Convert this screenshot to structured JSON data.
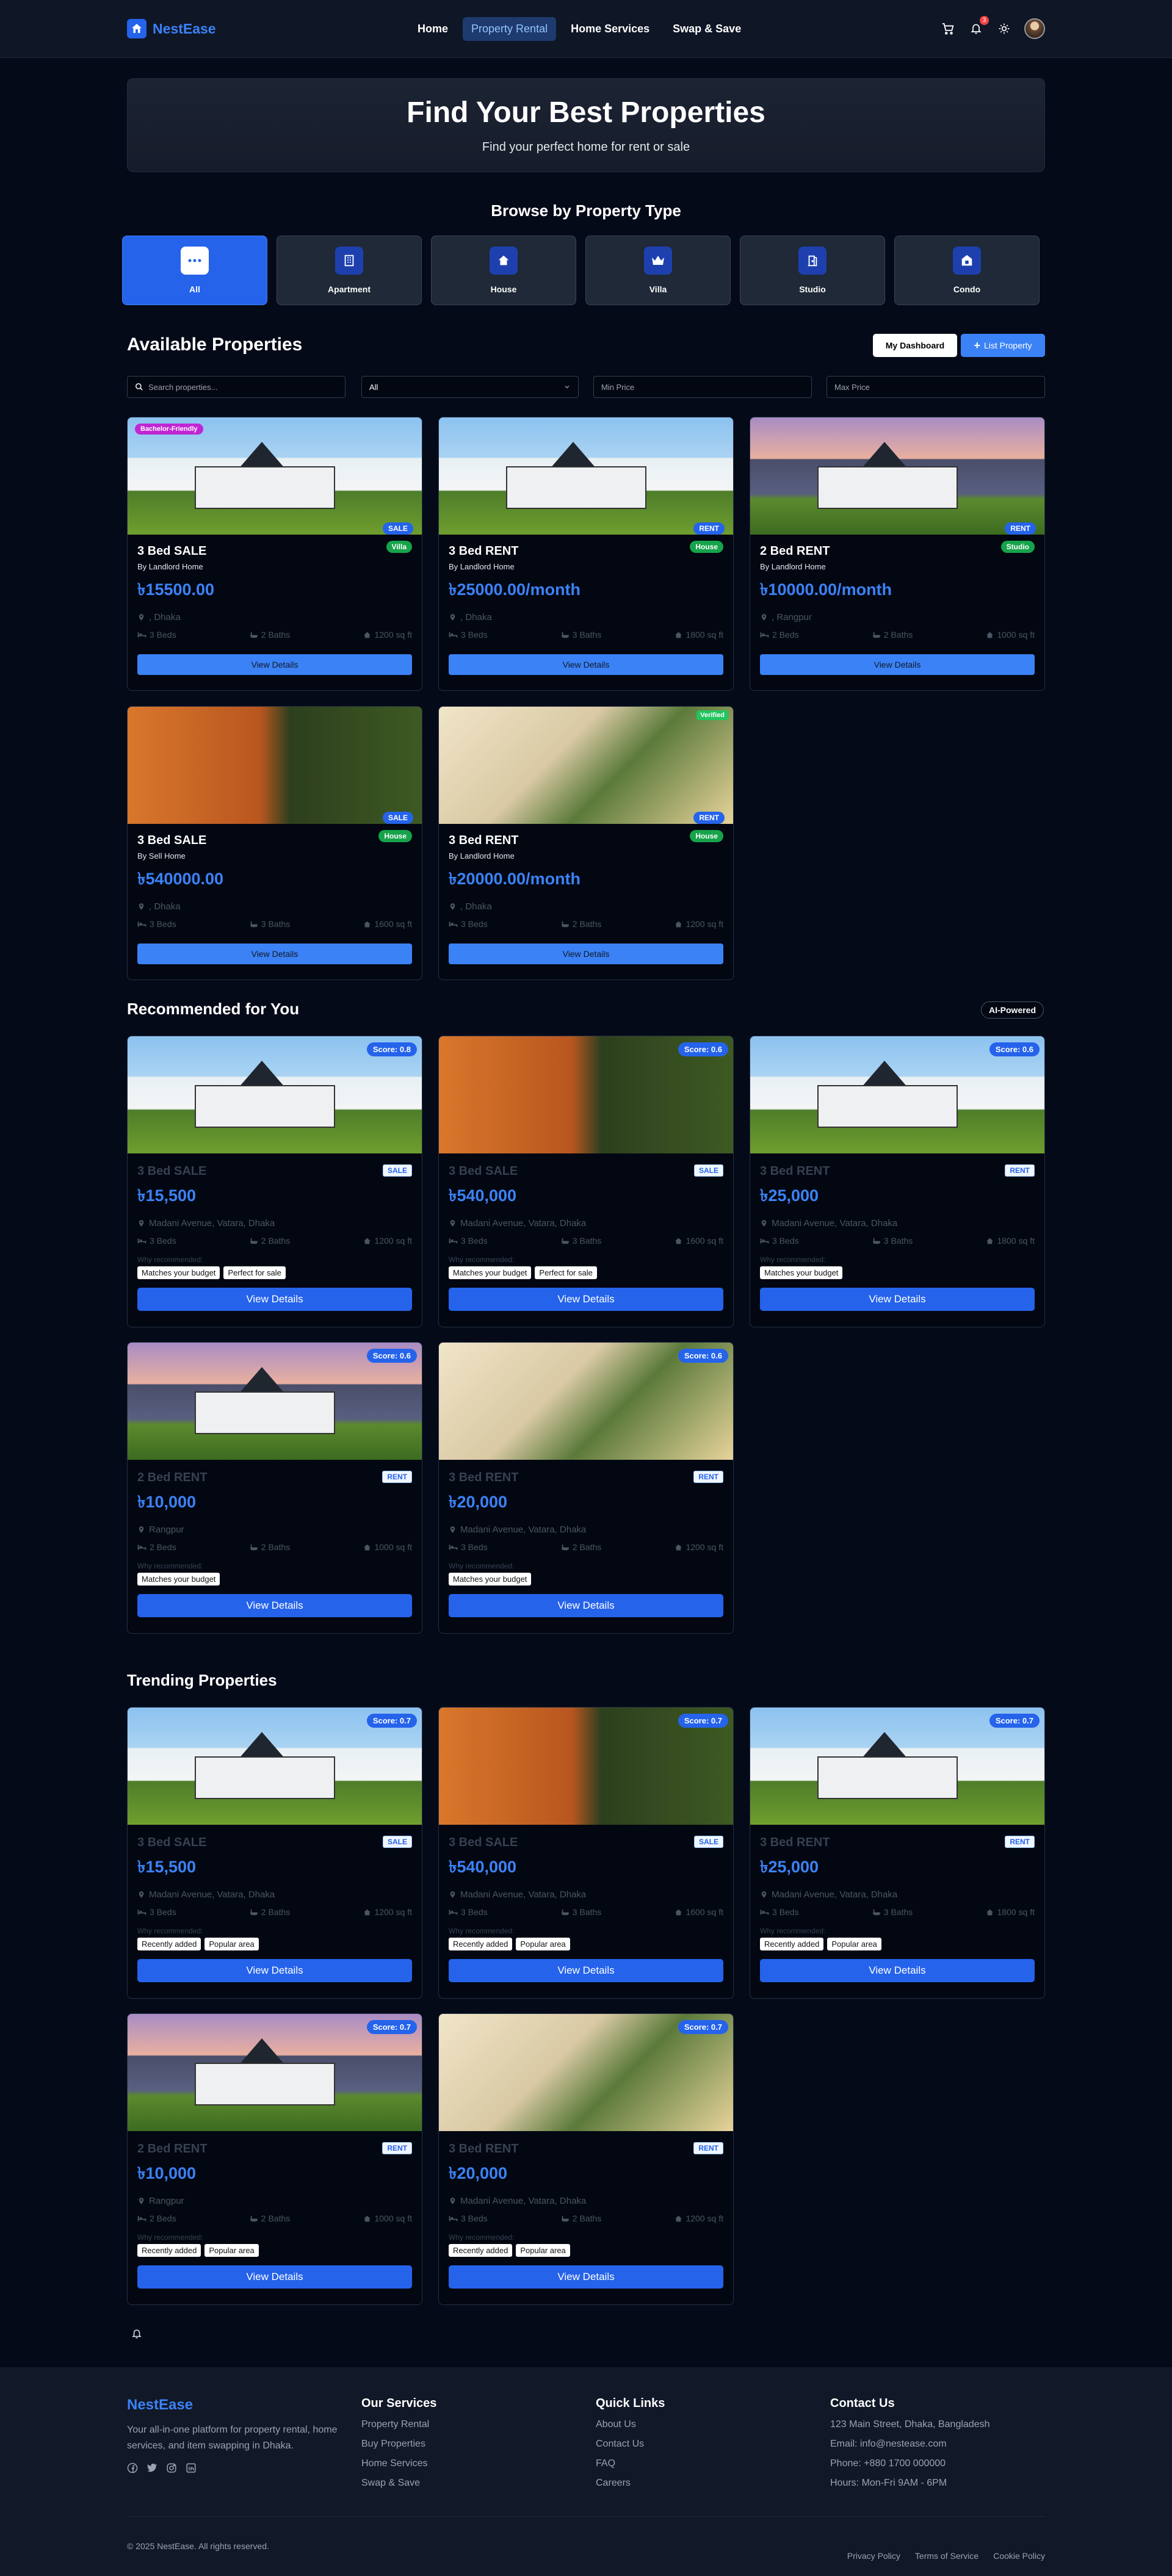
{
  "nav": {
    "brand": "NestEase",
    "links": [
      "Home",
      "Property Rental",
      "Home Services",
      "Swap & Save"
    ],
    "notif_count": "3"
  },
  "hero": {
    "title": "Find Your Best Properties",
    "subtitle": "Find your perfect home for rent or sale"
  },
  "types": {
    "title": "Browse by Property Type",
    "items": [
      "All",
      "Apartment",
      "House",
      "Villa",
      "Studio",
      "Condo"
    ]
  },
  "available": {
    "title": "Available Properties",
    "dashboard_label": "My Dashboard",
    "list_label": "List Property",
    "search_placeholder": "Search properties...",
    "type_filter": "All",
    "min_price": "Min Price",
    "max_price": "Max Price",
    "view_label": "View Details",
    "cards": [
      {
        "title": "3 Bed SALE",
        "by": "By Landlord Home",
        "price": "৳15500.00",
        "loc": ", Dhaka",
        "beds": "3 Beds",
        "baths": "2 Baths",
        "area": "1200 sq ft",
        "deal": "SALE",
        "kind": "Villa",
        "flag": "Bachelor-Friendly"
      },
      {
        "title": "3 Bed RENT",
        "by": "By Landlord Home",
        "price": "৳25000.00/month",
        "loc": ", Dhaka",
        "beds": "3 Beds",
        "baths": "3 Baths",
        "area": "1800 sq ft",
        "deal": "RENT",
        "kind": "House"
      },
      {
        "title": "2 Bed RENT",
        "by": "By Landlord Home",
        "price": "৳10000.00/month",
        "loc": ", Rangpur",
        "beds": "2 Beds",
        "baths": "2 Baths",
        "area": "1000 sq ft",
        "deal": "RENT",
        "kind": "Studio"
      },
      {
        "title": "3 Bed SALE",
        "by": "By Sell Home",
        "price": "৳540000.00",
        "loc": ", Dhaka",
        "beds": "3 Beds",
        "baths": "3 Baths",
        "area": "1600 sq ft",
        "deal": "SALE",
        "kind": "House"
      },
      {
        "title": "3 Bed RENT",
        "by": "By Landlord Home",
        "price": "৳20000.00/month",
        "loc": ", Dhaka",
        "beds": "3 Beds",
        "baths": "2 Baths",
        "area": "1200 sq ft",
        "deal": "RENT",
        "kind": "House",
        "flag": "Verified"
      }
    ]
  },
  "recommended": {
    "title": "Recommended for You",
    "badge": "AI-Powered",
    "why_label": "Why recommended:",
    "view_label": "View Details",
    "cards": [
      {
        "score": "Score: 0.8",
        "title": "3 Bed SALE",
        "deal": "SALE",
        "price": "৳15,500",
        "loc": "Madani Avenue, Vatara, Dhaka",
        "beds": "3 Beds",
        "baths": "2 Baths",
        "area": "1200 sq ft",
        "chips": [
          "Matches your budget",
          "Perfect for sale"
        ]
      },
      {
        "score": "Score: 0.6",
        "title": "3 Bed SALE",
        "deal": "SALE",
        "price": "৳540,000",
        "loc": "Madani Avenue, Vatara, Dhaka",
        "beds": "3 Beds",
        "baths": "3 Baths",
        "area": "1600 sq ft",
        "chips": [
          "Matches your budget",
          "Perfect for sale"
        ]
      },
      {
        "score": "Score: 0.6",
        "title": "3 Bed RENT",
        "deal": "RENT",
        "price": "৳25,000",
        "loc": "Madani Avenue, Vatara, Dhaka",
        "beds": "3 Beds",
        "baths": "3 Baths",
        "area": "1800 sq ft",
        "chips": [
          "Matches your budget"
        ]
      },
      {
        "score": "Score: 0.6",
        "title": "2 Bed RENT",
        "deal": "RENT",
        "price": "৳10,000",
        "loc": "Rangpur",
        "beds": "2 Beds",
        "baths": "2 Baths",
        "area": "1000 sq ft",
        "chips": [
          "Matches your budget"
        ]
      },
      {
        "score": "Score: 0.6",
        "title": "3 Bed RENT",
        "deal": "RENT",
        "price": "৳20,000",
        "loc": "Madani Avenue, Vatara, Dhaka",
        "beds": "3 Beds",
        "baths": "2 Baths",
        "area": "1200 sq ft",
        "chips": [
          "Matches your budget"
        ]
      }
    ]
  },
  "trending": {
    "title": "Trending Properties",
    "why_label": "Why recommended:",
    "view_label": "View Details",
    "cards": [
      {
        "score": "Score: 0.7",
        "title": "3 Bed SALE",
        "deal": "SALE",
        "price": "৳15,500",
        "loc": "Madani Avenue, Vatara, Dhaka",
        "beds": "3 Beds",
        "baths": "2 Baths",
        "area": "1200 sq ft",
        "chips": [
          "Recently added",
          "Popular area"
        ]
      },
      {
        "score": "Score: 0.7",
        "title": "3 Bed SALE",
        "deal": "SALE",
        "price": "৳540,000",
        "loc": "Madani Avenue, Vatara, Dhaka",
        "beds": "3 Beds",
        "baths": "3 Baths",
        "area": "1600 sq ft",
        "chips": [
          "Recently added",
          "Popular area"
        ]
      },
      {
        "score": "Score: 0.7",
        "title": "3 Bed RENT",
        "deal": "RENT",
        "price": "৳25,000",
        "loc": "Madani Avenue, Vatara, Dhaka",
        "beds": "3 Beds",
        "baths": "3 Baths",
        "area": "1800 sq ft",
        "chips": [
          "Recently added",
          "Popular area"
        ]
      },
      {
        "score": "Score: 0.7",
        "title": "2 Bed RENT",
        "deal": "RENT",
        "price": "৳10,000",
        "loc": "Rangpur",
        "beds": "2 Beds",
        "baths": "2 Baths",
        "area": "1000 sq ft",
        "chips": [
          "Recently added",
          "Popular area"
        ]
      },
      {
        "score": "Score: 0.7",
        "title": "3 Bed RENT",
        "deal": "RENT",
        "price": "৳20,000",
        "loc": "Madani Avenue, Vatara, Dhaka",
        "beds": "3 Beds",
        "baths": "2 Baths",
        "area": "1200 sq ft",
        "chips": [
          "Recently added",
          "Popular area"
        ]
      }
    ]
  },
  "footer": {
    "brand": "NestEase",
    "desc": "Your all-in-one platform for property rental, home services, and item swapping in Dhaka.",
    "services_title": "Our Services",
    "services": [
      "Property Rental",
      "Buy Properties",
      "Home Services",
      "Swap & Save"
    ],
    "links_title": "Quick Links",
    "links": [
      "About Us",
      "Contact Us",
      "FAQ",
      "Careers"
    ],
    "contact_title": "Contact Us",
    "contact": [
      "123 Main Street, Dhaka, Bangladesh",
      "Email: info@nestease.com",
      "Phone: +880 1700 000000",
      "Hours: Mon-Fri 9AM - 6PM"
    ],
    "copyright": "© 2025 NestEase. All rights reserved.",
    "legal": [
      "Privacy Policy",
      "Terms of Service",
      "Cookie Policy"
    ]
  },
  "colors": {
    "accent": "#3b82f6",
    "primary": "#2563eb",
    "success": "#16a34a",
    "bg": "#050a18"
  }
}
